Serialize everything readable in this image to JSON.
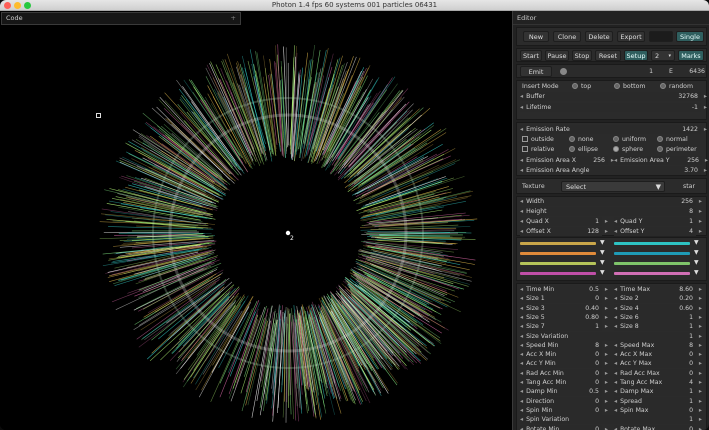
{
  "window": {
    "title": "Photon 1.4 fps 60 systems 001 particles 06431",
    "traffic_lights": {
      "close": "#ff5f57",
      "minimize": "#febc2e",
      "maximize": "#28c840"
    }
  },
  "canvas": {
    "code_label": "Code",
    "code_plus": "+",
    "system_marker": "2",
    "ring_colors": [
      "#33c7c3",
      "#7fe07f",
      "#e0b84c",
      "#c95f9a",
      "#b9ff7a",
      "#ffffff"
    ]
  },
  "editor": {
    "title": "Editor",
    "file_buttons": [
      "New",
      "Clone",
      "Delete",
      "Export"
    ],
    "single_label": "Single",
    "playback_buttons": [
      "Start",
      "Pause",
      "Stop",
      "Reset"
    ],
    "setup_label": "Setup",
    "setup_value": "2",
    "marks_label": "Marks",
    "emit": {
      "label": "Emit",
      "count": "1",
      "e_label": "E",
      "e_value": "6436"
    },
    "insert_mode": {
      "label": "Insert Mode",
      "options": [
        "top",
        "bottom",
        "random"
      ]
    },
    "buffer": {
      "label": "Buffer",
      "value": "32768"
    },
    "lifetime": {
      "label": "Lifetime",
      "value": "-1"
    },
    "emission_rate": {
      "label": "Emission Rate",
      "value": "1422"
    },
    "checks": [
      "outside",
      "relative"
    ],
    "shape_options": [
      "none",
      "uniform",
      "normal",
      "ellipse",
      "sphere",
      "perimeter"
    ],
    "emission_area_x": {
      "label": "Emission Area X",
      "value": "256"
    },
    "emission_area_y": {
      "label": "Emission Area Y",
      "value": "256"
    },
    "emission_area_angle": {
      "label": "Emission Area Angle",
      "value": "3.70"
    },
    "texture": {
      "label": "Texture",
      "select": "Select",
      "value": "star"
    },
    "width": {
      "label": "Width",
      "value": "256"
    },
    "height": {
      "label": "Height",
      "value": "8"
    },
    "quad_x": {
      "label": "Quad X",
      "value": "1"
    },
    "quad_y": {
      "label": "Quad Y",
      "value": "1"
    },
    "offset_x": {
      "label": "Offset X",
      "value": "128"
    },
    "offset_y": {
      "label": "Offset Y",
      "value": "4"
    },
    "color_swatches": [
      "#c9a64a",
      "#2ec3c3",
      "#e08a3a",
      "#1f9bb6",
      "#b5c45a",
      "#7fc46a",
      "#c04fa8",
      "#d16fb5"
    ],
    "params": [
      {
        "l": "Time Min",
        "lv": "0.5",
        "r": "Time Max",
        "rv": "8.60"
      },
      {
        "l": "Size 1",
        "lv": "0",
        "r": "Size 2",
        "rv": "0.20"
      },
      {
        "l": "Size 3",
        "lv": "0.40",
        "r": "Size 4",
        "rv": "0.60"
      },
      {
        "l": "Size 5",
        "lv": "0.80",
        "r": "Size 6",
        "rv": "1"
      },
      {
        "l": "Size 7",
        "lv": "1",
        "r": "Size 8",
        "rv": "1"
      },
      {
        "l": "Size Variation",
        "lv": "",
        "r": "",
        "rv": "1"
      },
      {
        "l": "Speed Min",
        "lv": "8",
        "r": "Speed Max",
        "rv": "8"
      },
      {
        "l": "Acc X Min",
        "lv": "0",
        "r": "Acc X Max",
        "rv": "0"
      },
      {
        "l": "Acc Y Min",
        "lv": "0",
        "r": "Acc Y Max",
        "rv": "0"
      },
      {
        "l": "Rad Acc Min",
        "lv": "0",
        "r": "Rad Acc Max",
        "rv": "0"
      },
      {
        "l": "Tang Acc Min",
        "lv": "0",
        "r": "Tang Acc Max",
        "rv": "4"
      },
      {
        "l": "Damp Min",
        "lv": "0.5",
        "r": "Damp Max",
        "rv": "1"
      },
      {
        "l": "Direction",
        "lv": "0",
        "r": "Spread",
        "rv": "1"
      },
      {
        "l": "Spin Min",
        "lv": "0",
        "r": "Spin Max",
        "rv": "0"
      },
      {
        "l": "Spin Variation",
        "lv": "",
        "r": "",
        "rv": "1"
      },
      {
        "l": "Rotate Min",
        "lv": "0",
        "r": "Rotate Max",
        "rv": "0"
      }
    ]
  }
}
